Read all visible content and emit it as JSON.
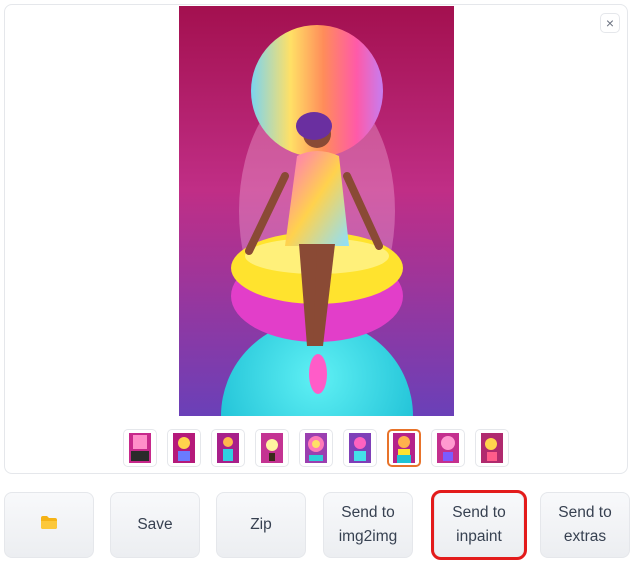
{
  "gallery": {
    "close_label": "×",
    "thumbnail_count": 9,
    "selected_index": 6
  },
  "buttons": {
    "open_folder": "📁",
    "save": "Save",
    "zip": "Zip",
    "send_img2img": "Send to\nimg2img",
    "send_inpaint": "Send to\ninpaint",
    "send_extras": "Send to\nextras"
  },
  "colors": {
    "highlight": "#e31b1b",
    "selected_thumb_border": "#e8732a",
    "folder_icon": "#f5b316"
  }
}
